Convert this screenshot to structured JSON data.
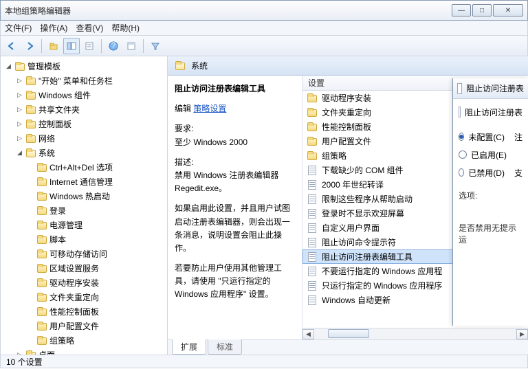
{
  "window": {
    "title": "本地组策略编辑器"
  },
  "menu": {
    "file": "文件(F)",
    "action": "操作(A)",
    "view": "查看(V)",
    "help": "帮助(H)"
  },
  "tree": {
    "root": "管理模板",
    "items": [
      "\"开始\" 菜单和任务栏",
      "Windows 组件",
      "共享文件夹",
      "控制面板",
      "网络"
    ],
    "system": "系统",
    "system_children": [
      "Ctrl+Alt+Del 选项",
      "Internet 通信管理",
      "Windows 热启动",
      "登录",
      "电源管理",
      "脚本",
      "可移动存储访问",
      "区域设置服务",
      "驱动程序安装",
      "文件夹重定向",
      "性能控制面板",
      "用户配置文件",
      "组策略"
    ],
    "desktop": "桌面"
  },
  "content": {
    "header": "系统",
    "desc_title": "阻止访问注册表编辑工具",
    "edit_label": "编辑",
    "edit_link": "策略设置",
    "req_label": "要求:",
    "req_value": "至少 Windows 2000",
    "desc_label": "描述:",
    "desc_text1": "禁用 Windows 注册表编辑器 Regedit.exe。",
    "desc_text2": "如果启用此设置，并且用户试图启动注册表编辑器，则会出现一条消息，说明设置会阻止此操作。",
    "desc_text3": "若要防止用户使用其他管理工具，请使用 \"只运行指定的 Windows 应用程序\" 设置。",
    "list_header": "设置",
    "list": [
      {
        "t": "folder",
        "l": "驱动程序安装"
      },
      {
        "t": "folder",
        "l": "文件夹重定向"
      },
      {
        "t": "folder",
        "l": "性能控制面板"
      },
      {
        "t": "folder",
        "l": "用户配置文件"
      },
      {
        "t": "folder",
        "l": "组策略"
      },
      {
        "t": "doc",
        "l": "下载缺少的 COM 组件"
      },
      {
        "t": "doc",
        "l": "2000 年世纪转译"
      },
      {
        "t": "doc",
        "l": "限制这些程序从帮助启动"
      },
      {
        "t": "doc",
        "l": "登录时不显示欢迎屏幕"
      },
      {
        "t": "doc",
        "l": "自定义用户界面"
      },
      {
        "t": "doc",
        "l": "阻止访问命令提示符"
      },
      {
        "t": "doc",
        "l": "阻止访问注册表编辑工具",
        "sel": true
      },
      {
        "t": "doc",
        "l": "不要运行指定的 Windows 应用程"
      },
      {
        "t": "doc",
        "l": "只运行指定的 Windows 应用程序"
      },
      {
        "t": "doc",
        "l": "Windows 自动更新"
      }
    ],
    "tabs": {
      "ext": "扩展",
      "std": "标准"
    }
  },
  "status": {
    "text": "10 个设置"
  },
  "dialog": {
    "title": "阻止访问注册表",
    "subtitle": "阻止访问注册表",
    "radio_unconfig": "未配置(C)",
    "radio_enabled": "已启用(E)",
    "radio_disabled": "已禁用(D)",
    "note_label": "注",
    "support_label": "支",
    "options_label": "选项:",
    "option_text": "是否禁用无提示运"
  }
}
